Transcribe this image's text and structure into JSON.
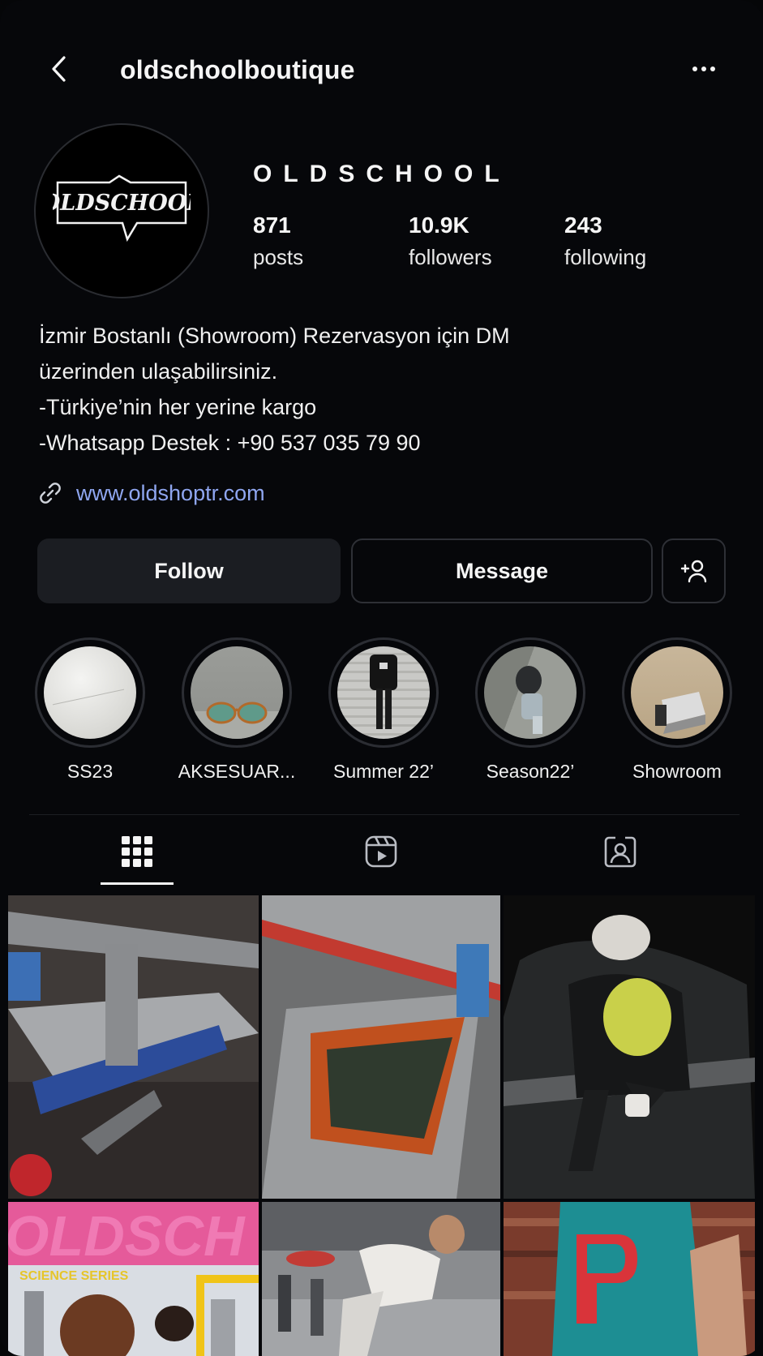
{
  "header": {
    "username": "oldschoolboutique",
    "back_icon": "chevron-left-icon",
    "more_icon": "more-horizontal-icon"
  },
  "profile": {
    "avatar_logo_text": "OLDSCHOOL",
    "display_name": "OLDSCHOOL",
    "stats": [
      {
        "value": "871",
        "label": "posts"
      },
      {
        "value": "10.9K",
        "label": "followers"
      },
      {
        "value": "243",
        "label": "following"
      }
    ],
    "bio_lines": [
      "İzmir Bostanlı (Showroom) Rezervasyon için DM",
      "üzerinden ulaşabilirsiniz.",
      "-Türkiye’nin her yerine kargo",
      "-Whatsapp Destek : +90 537 035 79 90"
    ],
    "link": "www.oldshoptr.com"
  },
  "actions": {
    "follow_label": "Follow",
    "message_label": "Message"
  },
  "highlights": [
    {
      "label": "SS23"
    },
    {
      "label": "AKSESUAR..."
    },
    {
      "label": "Summer 22’"
    },
    {
      "label": "Season22’"
    },
    {
      "label": "Showroom"
    }
  ],
  "tabs": [
    {
      "name": "posts-grid",
      "icon": "grid-icon",
      "active": true
    },
    {
      "name": "reels",
      "icon": "reels-icon",
      "active": false
    },
    {
      "name": "tagged",
      "icon": "tagged-person-icon",
      "active": false
    }
  ],
  "grid_overlay_text": {
    "post4_title": "OLDSCH",
    "post4_subtitle": "SCIENCE SERIES"
  },
  "colors": {
    "background": "#06070a",
    "link": "#8fa6f0",
    "follow_button": "#1b1d22",
    "outline": "#2e3036"
  }
}
